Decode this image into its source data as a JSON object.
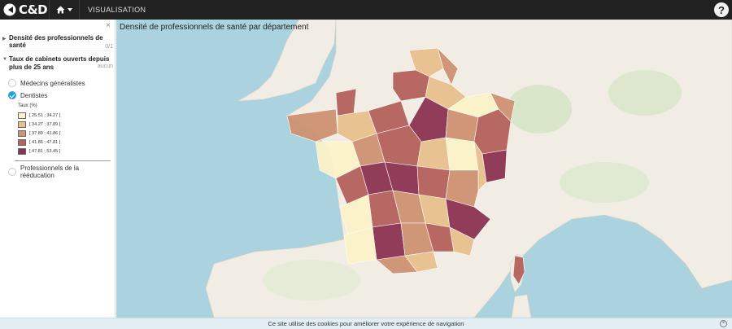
{
  "app": {
    "logo_text": "C&D",
    "nav_visualisation": "VISUALISATION",
    "help_label": "?"
  },
  "sidebar": {
    "close_label": "×",
    "layer_1": {
      "title": "Densité des professionnels de santé",
      "meta": "0/1"
    },
    "layer_2": {
      "title_line1": "Taux de cabinets ouverts depuis",
      "title_line2": "plus de 25 ans",
      "meta": "aucun"
    },
    "options": [
      {
        "label": "Médecins généralistes",
        "checked": false
      },
      {
        "label": "Dentistes",
        "checked": true
      },
      {
        "label": "Professionnels de la rééducation",
        "checked": false
      }
    ],
    "legend": {
      "title": "Taux (%)",
      "items": [
        {
          "label": "[ 25.51 ; 34.27 [",
          "color": "#fbf3c8"
        },
        {
          "label": "[ 34.27 ; 37.89 [",
          "color": "#e9c08d"
        },
        {
          "label": "[ 37.89 ; 41.86 [",
          "color": "#cf9273"
        },
        {
          "label": "[ 41.86 ; 47.81 [",
          "color": "#b5615d"
        },
        {
          "label": "[ 47.81 ; 53.45 ]",
          "color": "#8c3352"
        }
      ]
    }
  },
  "map": {
    "title": "Densité de professionnels de santé par département",
    "water_color": "#aad3df",
    "land_color": "#f1ede4"
  },
  "cookie_bar": {
    "text": "Ce site utilise des cookies pour améliorer votre expérience de navigation",
    "close_label": "×"
  }
}
